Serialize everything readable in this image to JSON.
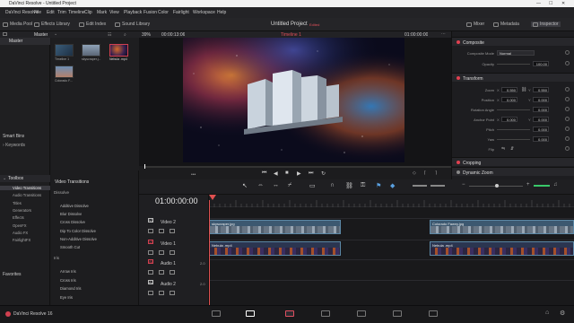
{
  "app": {
    "title": "DaVinci Resolve - Untitled Project",
    "menu": [
      "DaVinci Resolve",
      "File",
      "Edit",
      "Trim",
      "Timeline",
      "Clip",
      "Mark",
      "View",
      "Playback",
      "Fusion",
      "Color",
      "Fairlight",
      "Workspace",
      "Help"
    ]
  },
  "toolbar": {
    "media_pool": "Media Pool",
    "effects_library": "Effects Library",
    "edit_index": "Edit Index",
    "sound_library": "Sound Library",
    "project_title": "Untitled Project",
    "project_status": "Edited",
    "mixer": "Mixer",
    "metadata": "Metadata",
    "inspector": "Inspector"
  },
  "media_pool": {
    "bin_label": "Master",
    "bins": [
      "Master"
    ],
    "smart_bins_label": "Smart Bins",
    "keywords": "Keywords",
    "clips": [
      "Timeline 1",
      "skyscraper.j...",
      "Nebula .mp4",
      "Colorado F..."
    ]
  },
  "viewer": {
    "zoom": "39%",
    "timecode_in": "00:00:13:06",
    "timeline_name": "Timeline 1",
    "timecode_right": "01:00:00:00"
  },
  "inspector": {
    "composite": {
      "title": "Composite",
      "mode_label": "Composite Mode",
      "mode_value": "Normal",
      "opacity_label": "Opacity",
      "opacity_value": "100.00"
    },
    "transform": {
      "title": "Transform",
      "zoom_label": "Zoom",
      "zoom_x": "0.550",
      "zoom_y": "0.550",
      "x_label": "X",
      "y_label": "Y",
      "position_label": "Position",
      "pos_x": "0.000",
      "pos_y": "0.000",
      "rotation_label": "Rotation Angle",
      "rotation": "0.000",
      "anchor_label": "Anchor Point",
      "anchor_x": "0.000",
      "anchor_y": "0.000",
      "pitch_label": "Pitch",
      "pitch": "0.000",
      "yaw_label": "Yaw",
      "yaw": "0.000",
      "flip_label": "Flip"
    },
    "cropping": "Cropping",
    "dynamic_zoom": "Dynamic Zoom"
  },
  "effects": {
    "toolbox": "Toolbox",
    "categories": [
      "Video Transitions",
      "Audio Transitions",
      "Titles",
      "Generators",
      "Effects",
      "OpenFX",
      "Audio FX",
      "FairlightFX"
    ],
    "selected_category": "Video Transitions",
    "favorites": "Favorites",
    "panel_title": "Video Transitions",
    "group_dissolve": "Dissolve",
    "dissolve_items": [
      "Additive Dissolve",
      "Blur Dissolve",
      "Cross Dissolve",
      "Dip To Color Dissolve",
      "Non-Additive Dissolve",
      "Smooth Cut"
    ],
    "group_iris": "Iris",
    "iris_items": [
      "Arrow Iris",
      "Cross Iris",
      "Diamond Iris",
      "Eye Iris"
    ]
  },
  "timeline": {
    "timecode": "01:00:00:00",
    "tracks": [
      {
        "id": "V2",
        "name": "Video 2"
      },
      {
        "id": "V1",
        "name": "Video 1"
      },
      {
        "id": "A1",
        "name": "Audio 1",
        "level": "2.0"
      },
      {
        "id": "A2",
        "name": "Audio 2",
        "level": "2.0"
      }
    ],
    "clips": {
      "v2_a": "skyscraper.jpg",
      "v2_b": "Colorado Fawny.jpg",
      "v1_a": "Nebula .mp4",
      "v1_b": "Nebula .mp4"
    }
  },
  "status": {
    "app_name": "DaVinci Resolve 16"
  },
  "colors": {
    "accent_red": "#d04050",
    "video_clip": "#3c5870",
    "audio_clip": "#2f6a66"
  }
}
